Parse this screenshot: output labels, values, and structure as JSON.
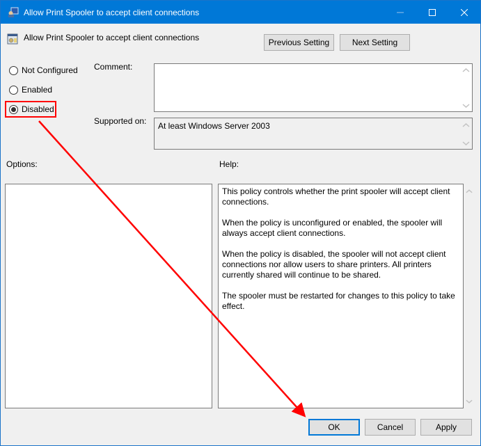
{
  "window": {
    "title": "Allow Print Spooler to accept client connections",
    "controls": {
      "minimize": "minimize",
      "maximize": "maximize",
      "close": "close"
    }
  },
  "header": {
    "policy_title": "Allow Print Spooler to accept client connections",
    "previous_label": "Previous Setting",
    "next_label": "Next Setting"
  },
  "state": {
    "options": [
      {
        "label": "Not Configured",
        "checked": false
      },
      {
        "label": "Enabled",
        "checked": false
      },
      {
        "label": "Disabled",
        "checked": true
      }
    ]
  },
  "comment": {
    "label": "Comment:",
    "value": ""
  },
  "supported": {
    "label": "Supported on:",
    "value": "At least Windows Server 2003"
  },
  "options_section": {
    "label": "Options:"
  },
  "help_section": {
    "label": "Help:",
    "paragraphs": [
      "This policy controls whether the print spooler will accept client connections.",
      "When the policy is unconfigured or enabled, the spooler will always accept client connections.",
      "When the policy is disabled, the spooler will not accept client connections nor allow users to share printers.  All printers currently shared will continue to be shared.",
      "The spooler must be restarted for changes to this policy to take effect."
    ]
  },
  "footer": {
    "ok_label": "OK",
    "cancel_label": "Cancel",
    "apply_label": "Apply"
  },
  "annotation": {
    "color": "#ff0000",
    "from": "Disabled radio",
    "to": "OK button"
  },
  "colors": {
    "titlebar": "#0078d7",
    "accent": "#0078d7",
    "annotation": "#ff0000"
  }
}
